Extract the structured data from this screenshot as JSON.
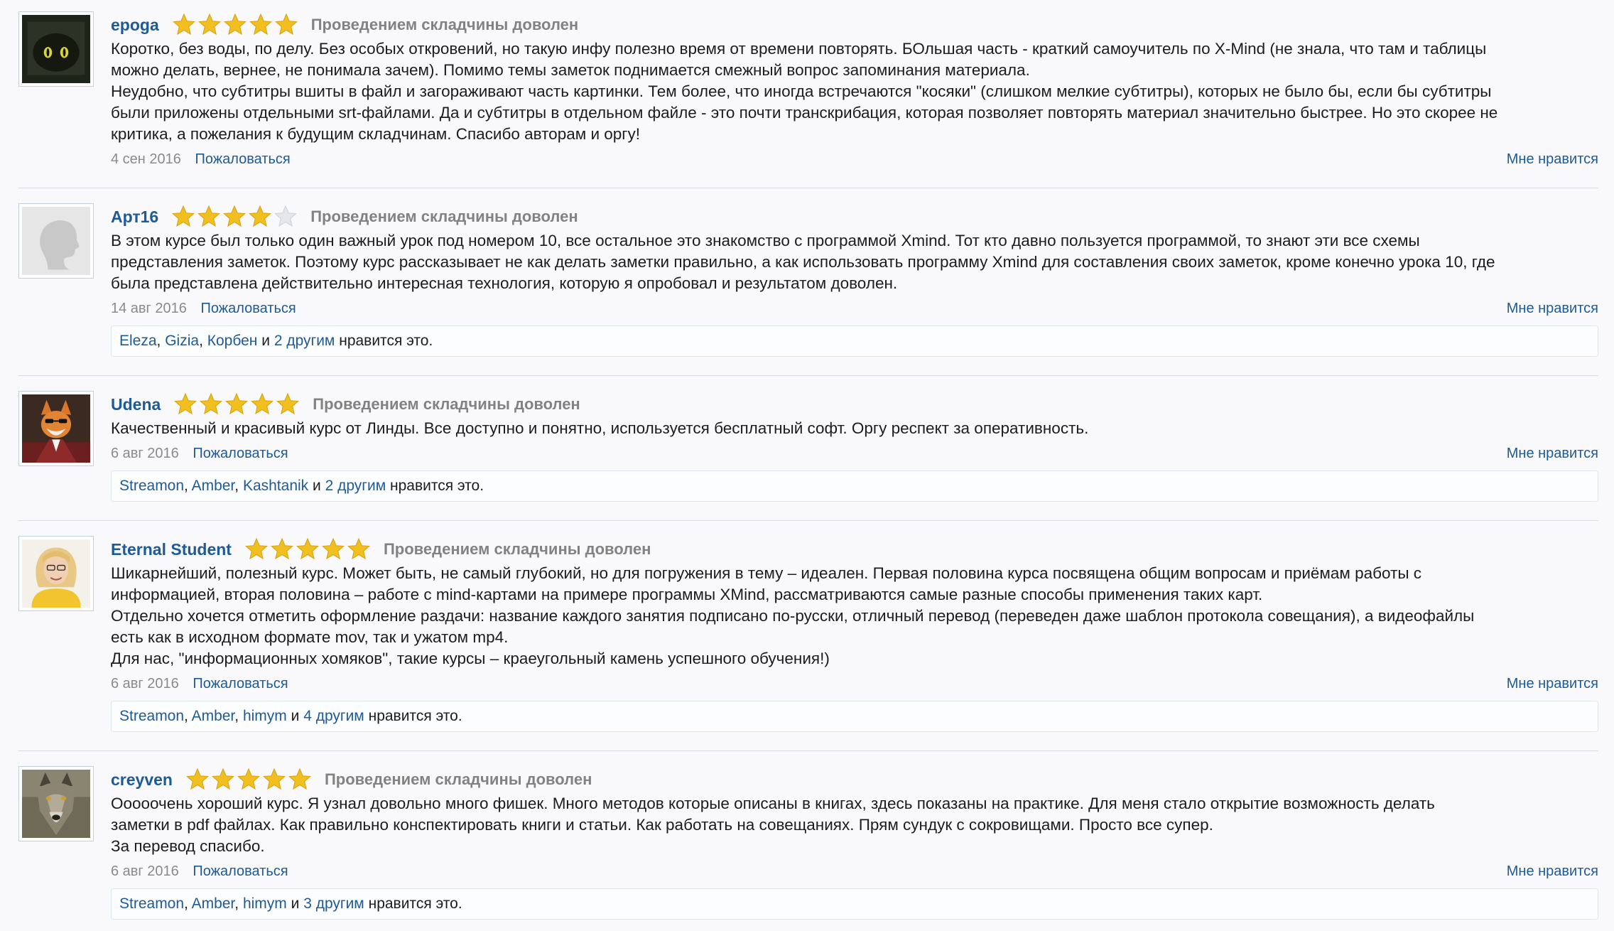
{
  "star_colors": {
    "filled": "#f2bf20",
    "empty": "#e4e6ea"
  },
  "reviews": [
    {
      "author": "epoga",
      "stars": 5,
      "rating_text": "Проведением складчины доволен",
      "avatar_icon": "cat-in-dark-avatar",
      "paragraphs": [
        "Коротко, без воды, по делу. Без особых откровений, но такую инфу полезно время от времени повторять. БОльшая часть - краткий самоучитель по X-Mind (не знала, что там и таблицы",
        "можно делать, вернее, не понимала зачем). Помимо темы заметок поднимается смежный вопрос запоминания материала.",
        "Неудобно, что субтитры вшиты в файл и загораживают часть картинки. Тем более, что иногда встречаются \"косяки\" (слишком мелкие субтитры), которых не было бы, если бы субтитры",
        "были приложены отдельными srt-файлами. Да и субтитры в отдельном файле - это почти транскрибация, которая позволяет повторять материал значительно быстрее. Но это скорее не",
        "критика, а пожелания к будущим складчинам. Спасибо авторам и оргу!"
      ],
      "date": "4 сен 2016",
      "report_label": "Пожаловаться",
      "like_label": "Мне нравится"
    },
    {
      "author": "Арт16",
      "stars": 4,
      "rating_text": "Проведением складчины доволен",
      "avatar_icon": "default-silhouette-avatar",
      "paragraphs": [
        "В этом курсе был только один важный урок под номером 10, все остальное это знакомство с программой Xmind. Тот кто давно пользуется программой, то знают эти все схемы",
        "представления заметок. Поэтому курс рассказывает не как делать заметки правильно, а как использовать программу Xmind для составления своих заметок, кроме конечно урока 10, где",
        "была представлена действительно интересная технология, которую я опробовал и результатом доволен."
      ],
      "date": "14 авг 2016",
      "report_label": "Пожаловаться",
      "like_label": "Мне нравится",
      "likes": {
        "users": [
          "Eleza",
          "Gizia",
          "Корбен"
        ],
        "and": "и",
        "others": "2 другим",
        "suffix": "нравится это."
      }
    },
    {
      "author": "Udena",
      "stars": 5,
      "rating_text": "Проведением складчины доволен",
      "avatar_icon": "fox-in-suit-avatar",
      "paragraphs": [
        "Качественный и красивый курс от Линды. Все доступно и понятно, используется бесплатный софт. Оргу респект за оперативность."
      ],
      "date": "6 авг 2016",
      "report_label": "Пожаловаться",
      "like_label": "Мне нравится",
      "likes": {
        "users": [
          "Streamon",
          "Amber",
          "Kashtanik"
        ],
        "and": "и",
        "others": "2 другим",
        "suffix": "нравится это."
      }
    },
    {
      "author": "Eternal Student",
      "stars": 5,
      "rating_text": "Проведением складчины доволен",
      "avatar_icon": "blonde-woman-avatar",
      "paragraphs": [
        "Шикарнейший, полезный курс. Может быть, не самый глубокий, но для погружения в тему – идеален. Первая половина курса посвящена общим вопросам и приёмам работы с",
        "информацией, вторая половина – работе с mind-картами на примере программы XMind, рассматриваются самые разные способы применения таких карт.",
        "Отдельно хочется отметить оформление раздачи: название каждого занятия подписано по-русски, отличный перевод (переведен даже шаблон протокола совещания), а видеофайлы",
        "есть как в исходном формате mov, так и ужатом mp4.",
        "Для нас, \"информационных хомяков\", такие курсы – краеугольный камень успешного обучения!)"
      ],
      "date": "6 авг 2016",
      "report_label": "Пожаловаться",
      "like_label": "Мне нравится",
      "likes": {
        "users": [
          "Streamon",
          "Amber",
          "himym"
        ],
        "and": "и",
        "others": "4 другим",
        "suffix": "нравится это."
      }
    },
    {
      "author": "creyven",
      "stars": 5,
      "rating_text": "Проведением складчины доволен",
      "avatar_icon": "wolf-avatar",
      "paragraphs": [
        "Ооооочень хороший курс. Я узнал довольно много фишек. Много методов которые описаны в книгах, здесь показаны на практике. Для меня стало открытие возможность делать",
        "заметки в pdf файлах. Как правильно конспектировать книги и статьи. Как работать на совещаниях. Прям сундук с сокровищами. Просто все супер.",
        "За перевод спасибо."
      ],
      "date": "6 авг 2016",
      "report_label": "Пожаловаться",
      "like_label": "Мне нравится",
      "likes": {
        "users": [
          "Streamon",
          "Amber",
          "himym"
        ],
        "and": "и",
        "others": "3 другим",
        "suffix": "нравится это."
      }
    }
  ]
}
